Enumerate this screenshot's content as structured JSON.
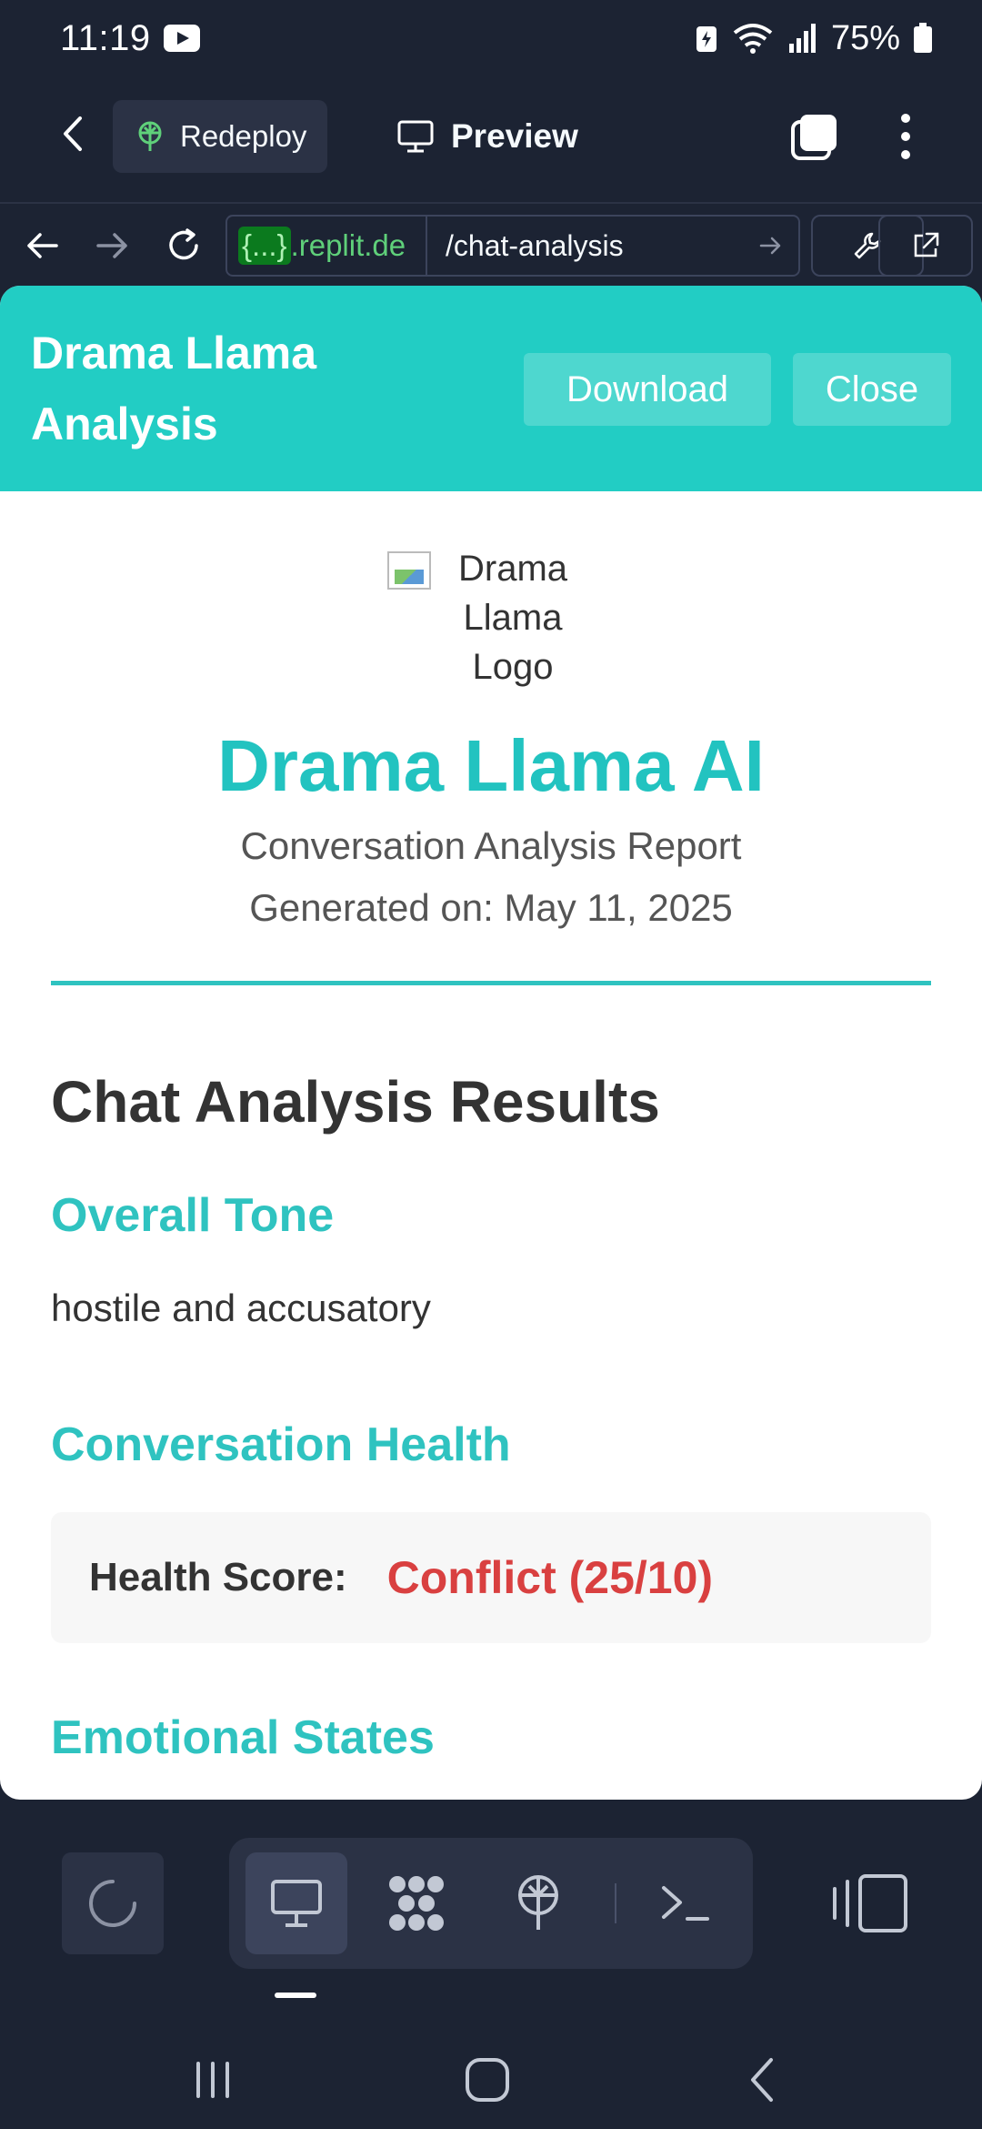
{
  "status_bar": {
    "time": "11:19",
    "battery": "75%",
    "icons": [
      "youtube-icon",
      "battery-saver-icon",
      "wifi-icon",
      "signal-icon",
      "battery-icon"
    ]
  },
  "top_bar": {
    "redeploy_label": "Redeploy",
    "preview_label": "Preview",
    "icons": [
      "back-chevron-icon",
      "deploy-icon",
      "monitor-icon",
      "tabs-icon",
      "more-vertical-icon"
    ]
  },
  "browser": {
    "domain_chip": "{...}",
    "domain_text": ".replit.de",
    "path": "/chat-analysis",
    "icons": [
      "back-arrow-icon",
      "forward-arrow-icon",
      "reload-icon",
      "go-arrow-icon",
      "wrench-icon",
      "external-link-icon"
    ]
  },
  "app": {
    "title": "Drama Llama Analysis",
    "download_label": "Download",
    "close_label": "Close",
    "logo_alt": "Drama Llama Logo",
    "report_title": "Drama Llama AI",
    "report_subtitle": "Conversation Analysis Report",
    "generated": "Generated on: May 11, 2025",
    "results_heading": "Chat Analysis Results",
    "tone_heading": "Overall Tone",
    "tone_value": "hostile and accusatory",
    "health_heading": "Conversation Health",
    "health_label": "Health Score:",
    "health_value": "Conflict (25/10)",
    "emotional_heading": "Emotional States"
  },
  "colors": {
    "accent": "#22cdc4",
    "heading_teal": "#2fc3c0",
    "conflict_red": "#d94040",
    "chrome_bg": "#1c2333"
  },
  "bottom_toolbar": {
    "icons": [
      "loading-spinner-icon",
      "monitor-icon",
      "packages-icon",
      "deploy-icon",
      "terminal-icon",
      "panel-layout-icon"
    ]
  }
}
